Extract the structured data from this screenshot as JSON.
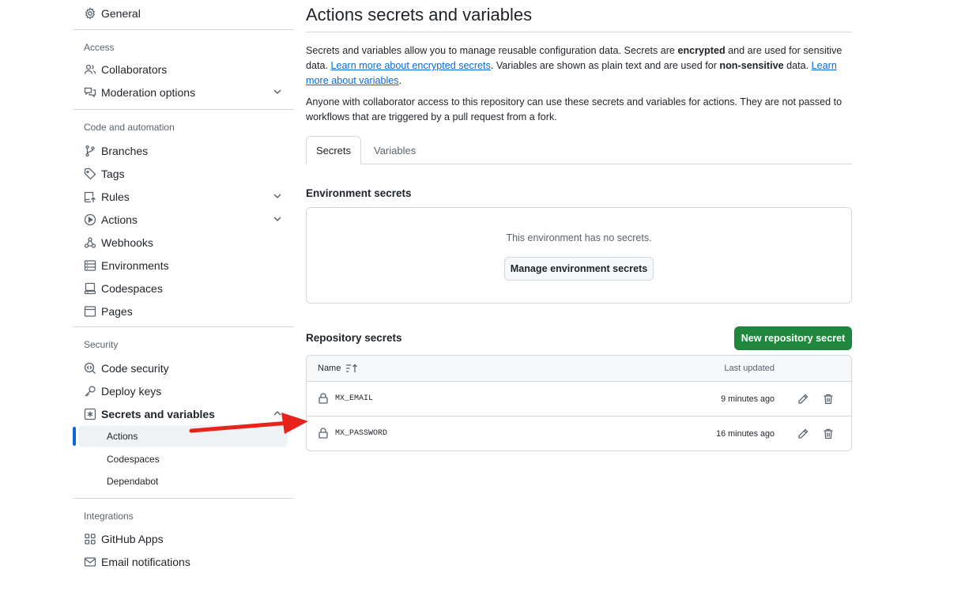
{
  "sidebar": {
    "general": "General",
    "groups": {
      "access": "Access",
      "code_automation": "Code and automation",
      "security": "Security",
      "integrations": "Integrations"
    },
    "access_items": [
      {
        "label": "Collaborators",
        "icon": "people-icon"
      },
      {
        "label": "Moderation options",
        "icon": "comment-discussion-icon"
      }
    ],
    "code_items": [
      {
        "label": "Branches",
        "icon": "git-branch-icon"
      },
      {
        "label": "Tags",
        "icon": "tag-icon"
      },
      {
        "label": "Rules",
        "icon": "repo-push-icon"
      },
      {
        "label": "Actions",
        "icon": "play-icon"
      },
      {
        "label": "Webhooks",
        "icon": "webhook-icon"
      },
      {
        "label": "Environments",
        "icon": "server-icon"
      },
      {
        "label": "Codespaces",
        "icon": "codespaces-icon"
      },
      {
        "label": "Pages",
        "icon": "browser-icon"
      }
    ],
    "security_items": [
      {
        "label": "Code security",
        "icon": "codescan-icon"
      },
      {
        "label": "Deploy keys",
        "icon": "key-icon"
      },
      {
        "label": "Secrets and variables",
        "icon": "key-asterisk-icon"
      }
    ],
    "secrets_sub": [
      {
        "label": "Actions",
        "active": true
      },
      {
        "label": "Codespaces"
      },
      {
        "label": "Dependabot"
      }
    ],
    "integration_items": [
      {
        "label": "GitHub Apps",
        "icon": "apps-icon"
      },
      {
        "label": "Email notifications",
        "icon": "mail-icon"
      }
    ]
  },
  "main": {
    "title": "Actions secrets and variables",
    "intro": {
      "p1a": "Secrets and variables allow you to manage reusable configuration data. Secrets are ",
      "p1b": "encrypted",
      "p1c": " and are used for sensitive data. ",
      "link1": "Learn more about encrypted secrets",
      "p1d": ". Variables are shown as plain text and are used for ",
      "p1e": "non-sensitive",
      "p1f": " data. ",
      "link2": "Learn more about variables",
      "p1g": ".",
      "p2": "Anyone with collaborator access to this repository can use these secrets and variables for actions. They are not passed to workflows that are triggered by a pull request from a fork."
    },
    "tabs": [
      {
        "label": "Secrets",
        "selected": true
      },
      {
        "label": "Variables"
      }
    ],
    "env_title": "Environment secrets",
    "env_empty": "This environment has no secrets.",
    "env_button": "Manage environment secrets",
    "repo_title": "Repository secrets",
    "new_button": "New repository secret",
    "table": {
      "col_name": "Name",
      "col_updated": "Last updated",
      "rows": [
        {
          "name": "MX_EMAIL",
          "updated": "9 minutes ago"
        },
        {
          "name": "MX_PASSWORD",
          "updated": "16 minutes ago"
        }
      ]
    }
  },
  "colors": {
    "accent": "#0969da",
    "primary_button": "#1f883d",
    "arrow": "#e8231b"
  }
}
